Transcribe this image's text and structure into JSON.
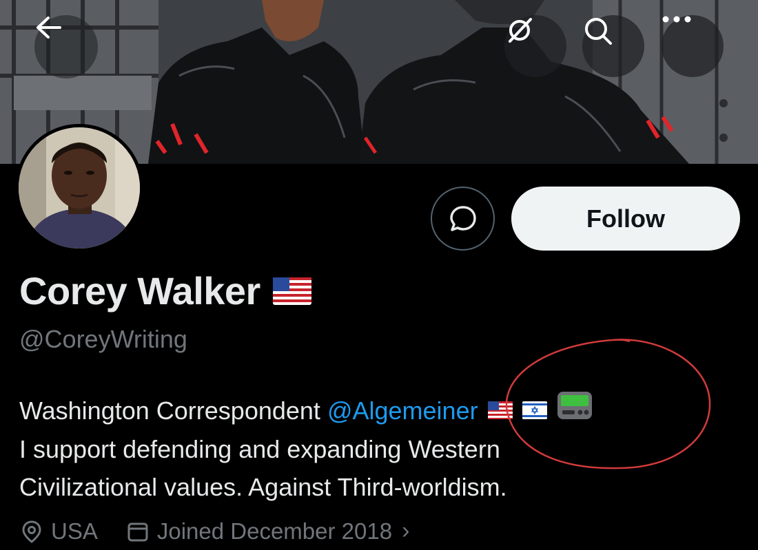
{
  "colors": {
    "background": "#000000",
    "text_primary": "#e7e9ea",
    "text_secondary": "#71767b",
    "link": "#1d9bf0",
    "follow_bg": "#eff3f4",
    "annotation": "#d23b3b"
  },
  "header": {
    "back_icon": "arrow-left-icon",
    "grok_icon": "slashed-circle-icon",
    "search_icon": "search-icon",
    "more_icon": "more-dots-icon"
  },
  "profile": {
    "display_name": "Corey Walker",
    "name_emoji": "us-flag-emoji",
    "handle": "@CoreyWriting",
    "follow_label": "Follow",
    "message_icon": "message-bubble-icon"
  },
  "bio": {
    "line1_text": "Washington Correspondent ",
    "mention": "@Algemeiner",
    "emojis": [
      "us-flag-emoji",
      "israel-flag-emoji",
      "pager-emoji"
    ],
    "line2": "I support defending and expanding Western",
    "line3": "Civilizational values. Against Third-worldism."
  },
  "meta": {
    "location": "USA",
    "location_icon": "location-pin-icon",
    "joined": "Joined December 2018",
    "joined_icon": "calendar-icon",
    "chevron": "›"
  }
}
